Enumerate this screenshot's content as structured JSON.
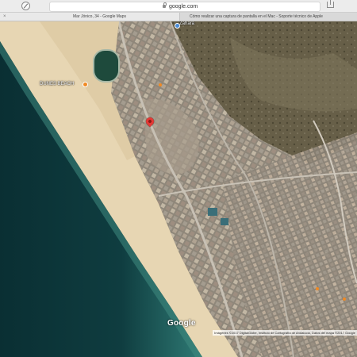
{
  "browser": {
    "url": "google.com",
    "tabs": [
      {
        "title": "Mar Jónico, 34 - Google Maps",
        "close_glyph": "×"
      },
      {
        "title": "Cómo realizar una captura de pantalla en el Mac - Soporte técnico de Apple"
      }
    ],
    "icons": [
      "compass-icon",
      "lock-icon",
      "share-icon",
      "close-icon"
    ]
  },
  "map": {
    "type": "satellite",
    "labels": {
      "town": "Zahara",
      "place": "DUNES BEACH"
    },
    "logo": "Google",
    "attribution": "Imágenes ©2017 DigitalGlobe, Instituto de Cartografía de Andalucía, Datos del mapa ©2017 Google"
  },
  "colors": {
    "sea": "#0e3a3b",
    "sand": "#e7d6b3",
    "land": "#6b6650",
    "town": "#9b9185",
    "pin": "#e53935",
    "poi": "#f08a24"
  }
}
